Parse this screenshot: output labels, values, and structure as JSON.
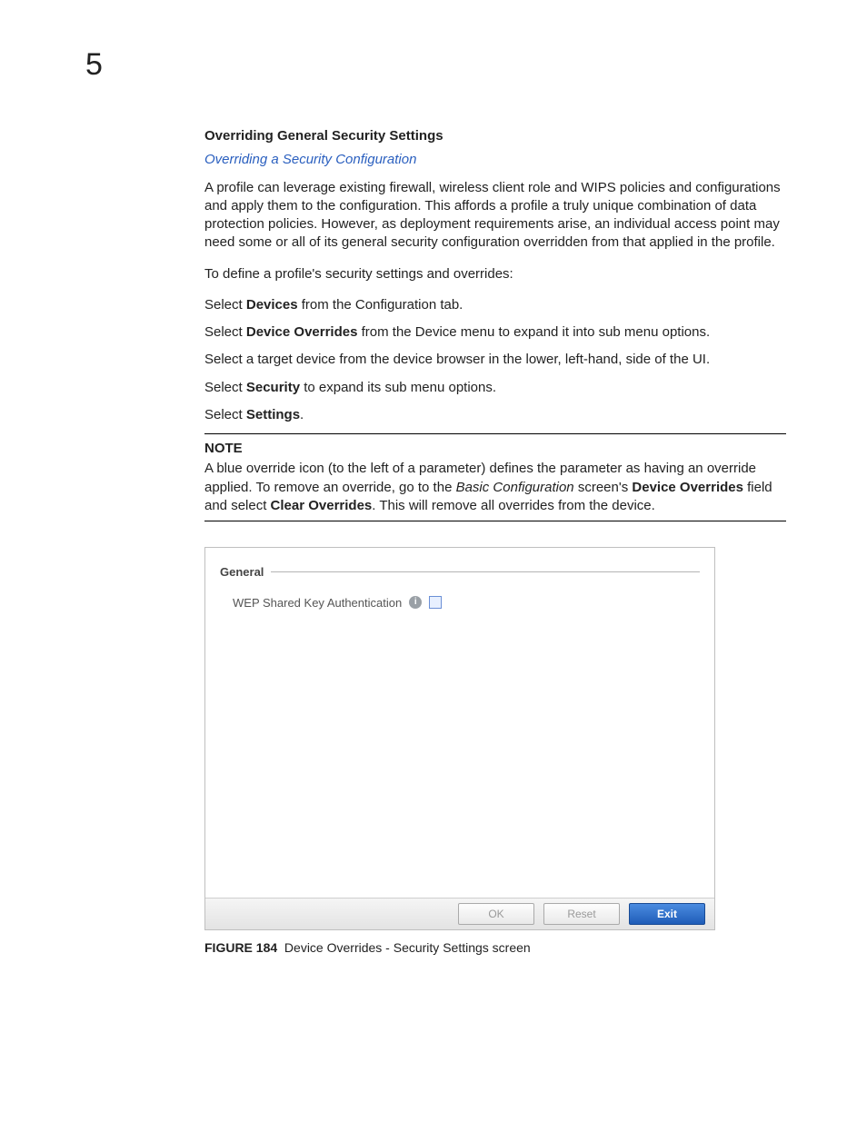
{
  "chapter_number": "5",
  "heading": "Overriding General Security Settings",
  "link_text": "Overriding a Security Configuration",
  "intro": "A profile can leverage existing firewall, wireless client role and WIPS policies and configurations and apply them to the configuration. This affords a profile a truly unique combination of data protection policies. However, as deployment requirements arise, an individual access point may need some or all of its general security configuration overridden from that applied in the profile.",
  "lead_in": "To define a profile's security settings and overrides:",
  "step1_pre": "Select ",
  "step1_bold": "Devices",
  "step1_post": " from the Configuration tab.",
  "step2_pre": "Select ",
  "step2_bold": "Device Overrides",
  "step2_post": " from the Device menu to expand it into sub menu options.",
  "step3": "Select a target device from the device browser in the lower, left-hand, side of the UI.",
  "step4_pre": "Select ",
  "step4_bold": "Security",
  "step4_post": " to expand its sub menu options.",
  "step5_pre": "Select ",
  "step5_bold": "Settings",
  "step5_post": ".",
  "note": {
    "label": "NOTE",
    "line1": "A blue override icon (to the left of a parameter) defines the parameter as having an override applied.",
    "line2_pre": "To remove an override, go to the ",
    "line2_ital": "Basic Configuration",
    "line2_mid": " screen's ",
    "line2_bold1": "Device Overrides",
    "line2_mid2": " field and select ",
    "line2_bold2": "Clear Overrides",
    "line2_post": ". This will remove all overrides from the device."
  },
  "panel": {
    "fieldset_label": "General",
    "field_label": "WEP Shared Key Authentication",
    "buttons": {
      "ok": "OK",
      "reset": "Reset",
      "exit": "Exit"
    }
  },
  "figure": {
    "num": "FIGURE 184",
    "caption": "Device Overrides - Security Settings screen"
  }
}
